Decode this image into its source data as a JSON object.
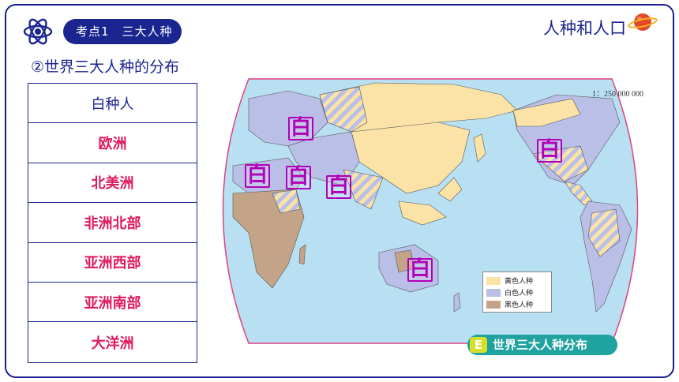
{
  "header": {
    "pill_label": "考点1　三大人种",
    "topic_title": "人种和人口",
    "logo_icon": "atom-icon",
    "planet_icon": "planet-icon"
  },
  "subtitle": "②世界三大人种的分布",
  "table": {
    "heading": "白种人",
    "rows": [
      "欧洲",
      "北美洲",
      "非洲北部",
      "亚洲西部",
      "亚洲南部",
      "大洋洲"
    ]
  },
  "map": {
    "scale": "1：250 000 000",
    "marker_text": "白",
    "legend": [
      {
        "label": "黄色人种",
        "color": "#fbe3a7"
      },
      {
        "label": "白色人种",
        "color": "#b9bfe6"
      },
      {
        "label": "黑色人种",
        "color": "#c4a489"
      }
    ],
    "caption_badge": "E",
    "caption": "世界三大人种分布"
  },
  "colors": {
    "primary": "#1b2590",
    "accent_red": "#e0185d",
    "marker": "#b100b8",
    "caption_bg": "#1fa2a0",
    "ocean": "#b8e0f2"
  }
}
